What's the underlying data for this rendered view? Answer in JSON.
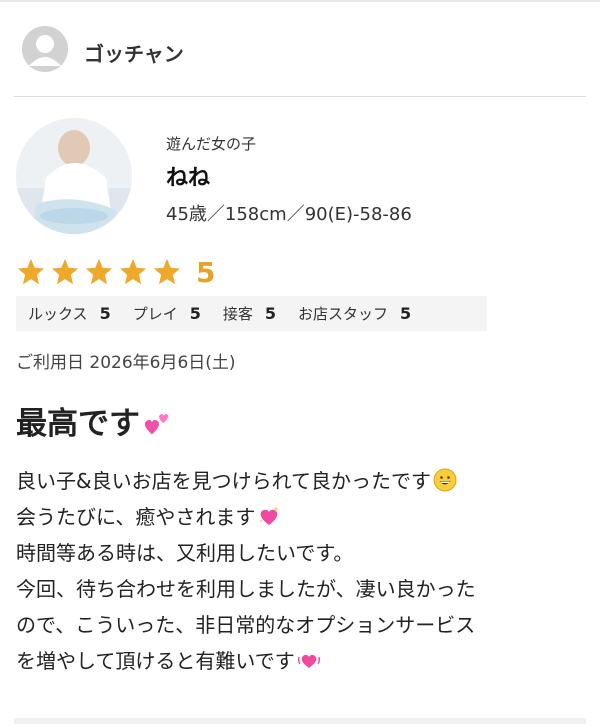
{
  "reviewer": {
    "name": "ゴッチャン"
  },
  "girl": {
    "label": "遊んだ女の子",
    "name": "ねね",
    "stats": "45歳／158cm／90(E)-58-86"
  },
  "rating": {
    "score": "5",
    "stars": 5,
    "color": "#f0a82a"
  },
  "subscores": [
    {
      "label": "ルックス",
      "value": "5"
    },
    {
      "label": "プレイ",
      "value": "5"
    },
    {
      "label": "接客",
      "value": "5"
    },
    {
      "label": "お店スタッフ",
      "value": "5"
    }
  ],
  "visit_date": "ご利用日 2026年6月6日(土)",
  "review": {
    "title": "最高です",
    "title_emoji": "two-hearts-icon",
    "lines": [
      {
        "text": "良い子&良いお店を見つけられて良かったです",
        "emoji": "grinning-face-icon"
      },
      {
        "text": "会うたびに、癒やされます",
        "emoji": "sparkling-heart-icon"
      },
      {
        "text": "時間等ある時は、又利用したいです。",
        "emoji": ""
      },
      {
        "text": "今回、待ち合わせを利用しましたが、凄い良かった",
        "emoji": ""
      },
      {
        "text": "ので、こういった、非日常的なオプションサービス",
        "emoji": ""
      },
      {
        "text": "を増やして頂けると有難いです",
        "emoji": "beating-heart-icon"
      }
    ]
  }
}
